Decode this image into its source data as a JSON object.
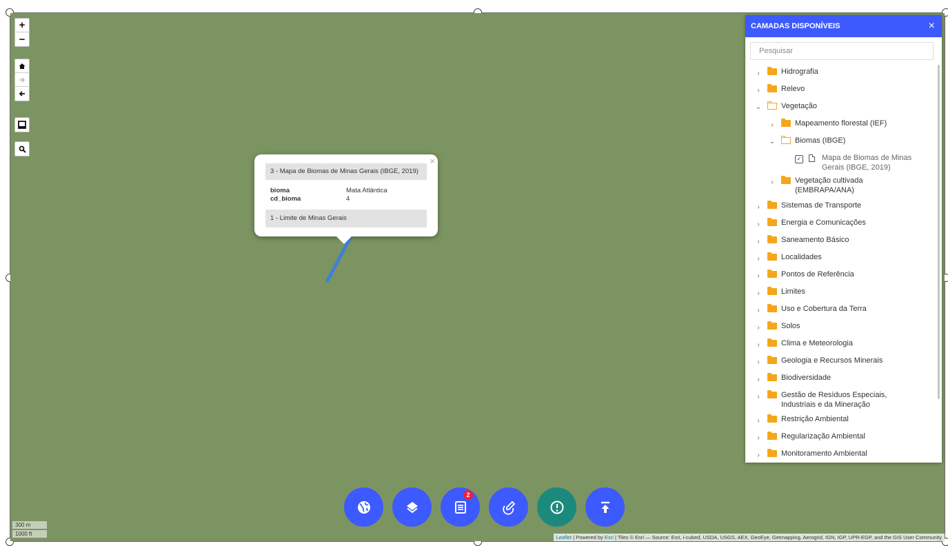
{
  "map_controls": {
    "zoom_in": "+",
    "zoom_out": "−"
  },
  "popup": {
    "header": "3 - Mapa de Biomas de Minas Gerais (IBGE, 2019)",
    "close": "×",
    "fields": [
      {
        "key": "bioma",
        "value": "Mata Atlântica"
      },
      {
        "key": "cd_bioma",
        "value": "4"
      }
    ],
    "footer": "1 - Limite de Minas Gerais"
  },
  "panel": {
    "title": "CAMADAS DISPONÍVEIS",
    "close": "×",
    "search_placeholder": "Pesquisar",
    "items": [
      {
        "label": "Hidrografia",
        "state": "closed",
        "level": 0
      },
      {
        "label": "Relevo",
        "state": "closed",
        "level": 0
      },
      {
        "label": "Vegetação",
        "state": "open",
        "level": 0
      },
      {
        "label": "Mapeamento florestal (IEF)",
        "state": "closed",
        "level": 1
      },
      {
        "label": "Biomas (IBGE)",
        "state": "open",
        "level": 1
      },
      {
        "label": "Mapa de Biomas de Minas Gerais (IBGE, 2019)",
        "state": "layer",
        "level": 2,
        "checked": true
      },
      {
        "label": "Vegetação cultivada (EMBRAPA/ANA)",
        "state": "closed",
        "level": 1
      },
      {
        "label": "Sistemas de Transporte",
        "state": "closed",
        "level": 0
      },
      {
        "label": "Energia e Comunicações",
        "state": "closed",
        "level": 0
      },
      {
        "label": "Saneamento Básico",
        "state": "closed",
        "level": 0
      },
      {
        "label": "Localidades",
        "state": "closed",
        "level": 0
      },
      {
        "label": "Pontos de Referência",
        "state": "closed",
        "level": 0
      },
      {
        "label": "Limites",
        "state": "closed",
        "level": 0
      },
      {
        "label": "Uso e Cobertura da Terra",
        "state": "closed",
        "level": 0
      },
      {
        "label": "Solos",
        "state": "closed",
        "level": 0
      },
      {
        "label": "Clima e Meteorologia",
        "state": "closed",
        "level": 0
      },
      {
        "label": "Geologia e Recursos Minerais",
        "state": "closed",
        "level": 0
      },
      {
        "label": "Biodiversidade",
        "state": "closed",
        "level": 0
      },
      {
        "label": "Gestão de Resíduos Especiais, Industriais e da Mineração",
        "state": "closed",
        "level": 0
      },
      {
        "label": "Restrição Ambiental",
        "state": "closed",
        "level": 0
      },
      {
        "label": "Regularização Ambiental",
        "state": "closed",
        "level": 0
      },
      {
        "label": "Monitoramento Ambiental",
        "state": "closed",
        "level": 0
      }
    ]
  },
  "toolbar": {
    "badge_count": "2"
  },
  "scale": {
    "metric": "300 m",
    "imperial": "1000 ft"
  },
  "attribution": {
    "leaflet": "Leaflet",
    "sep1": " | Powered by ",
    "esri": "Esri",
    "rest": " | Tiles © Esri — Source: Esri, i-cubed, USDA, USGS, AEX, GeoEye, Getmapping, Aerogrid, IGN, IGP, UPR-EGP, and the GIS User Community"
  },
  "colors": {
    "map_bg": "#7c9461",
    "accent": "#3d5afe",
    "teal": "#1b8a7d",
    "folder": "#f4a71b",
    "badge": "#ee1f3b"
  }
}
